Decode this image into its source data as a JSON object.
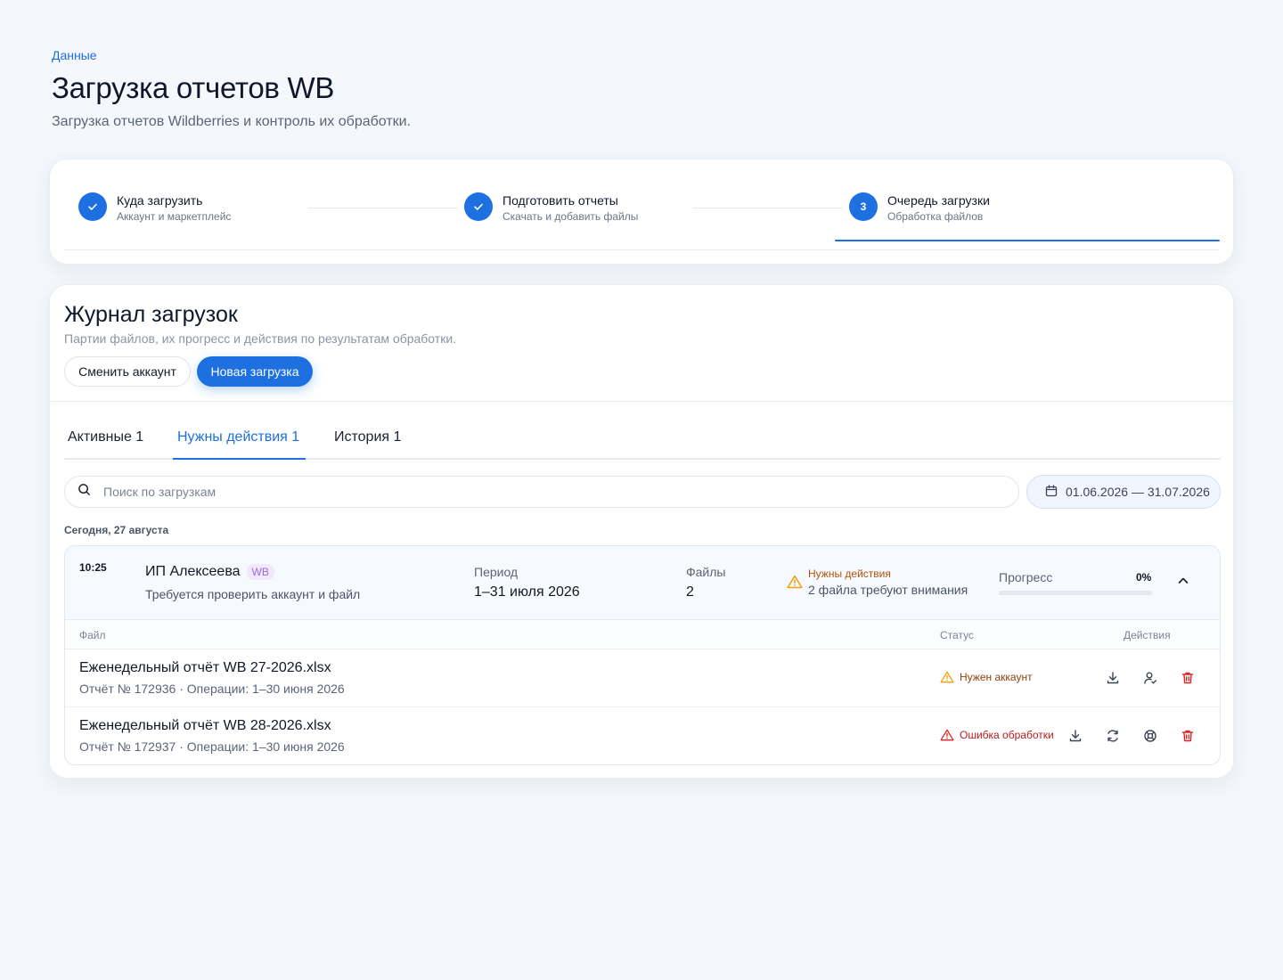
{
  "header": {
    "breadcrumb": "Данные",
    "title": "Загрузка отчетов WB",
    "subtitle": "Загрузка отчетов Wildberries и контроль их обработки."
  },
  "stepper": {
    "steps": [
      {
        "title": "Куда загрузить",
        "desc": "Аккаунт и маркетплейс",
        "state": "done"
      },
      {
        "title": "Подготовить отчеты",
        "desc": "Скачать и добавить файлы",
        "state": "done"
      },
      {
        "number": "3",
        "title": "Очередь загрузки",
        "desc": "Обработка файлов",
        "state": "active"
      }
    ]
  },
  "journal": {
    "title": "Журнал загрузок",
    "subtitle": "Партии файлов, их прогресс и действия по результатам обработки.",
    "switch_account_label": "Сменить аккаунт",
    "new_upload_label": "Новая загрузка",
    "tabs": [
      {
        "label": "Активные 1"
      },
      {
        "label": "Нужны действия 1",
        "active": true
      },
      {
        "label": "История 1"
      }
    ],
    "search": {
      "placeholder": "Поиск по загрузкам",
      "value": ""
    },
    "date_range": "01.06.2026 — 31.07.2026",
    "group_label": "Сегодня, 27 августа",
    "batch": {
      "time": "10:25",
      "account": "ИП Алексеева",
      "marketplace": "WB",
      "note": "Требуется проверить аккаунт и файл",
      "period_label": "Период",
      "period_value": "1–31 июля 2026",
      "files_label": "Файлы",
      "files_value": "2",
      "warning_title": "Нужны действия",
      "warning_desc": "2 файла требуют внимания",
      "progress_label": "Прогресс",
      "progress_text": "0%",
      "progress_value": 0,
      "table_headers": {
        "file": "Файл",
        "status": "Статус",
        "actions": "Действия"
      },
      "files": [
        {
          "name": "Еженедельный отчёт WB 27-2026.xlsx",
          "meta": "Отчёт № 172936 · Операции: 1–30 июня 2026",
          "status": "Нужен аккаунт",
          "status_type": "warning"
        },
        {
          "name": "Еженедельный отчёт WB 28-2026.xlsx",
          "meta": "Отчёт № 172937 · Операции: 1–30 июня 2026",
          "status": "Ошибка обработки",
          "status_type": "error"
        }
      ]
    }
  },
  "colors": {
    "accent": "#1e6fe0",
    "warning": "#f59e0b",
    "error": "#dc2626",
    "background": "#f4f7fc"
  }
}
